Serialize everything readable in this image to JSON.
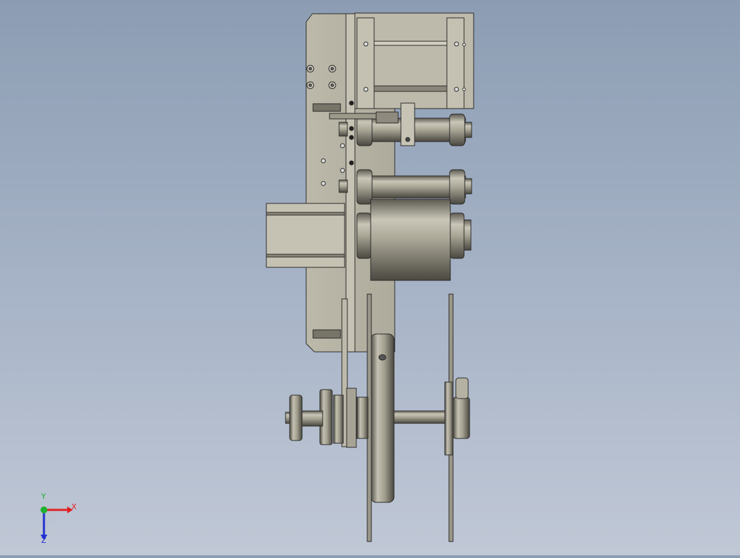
{
  "viewport": {
    "background_top": "#8c9db3",
    "background_bottom": "#c0c8d6",
    "part_color": "#b7b4a4",
    "part_dark": "#6f6c60",
    "edge_color": "#2a2a28"
  },
  "triad": {
    "x_label": "X",
    "y_label": "Y",
    "z_label": "Z",
    "x_color": "#e02020",
    "y_color": "#20b030",
    "z_color": "#2030d0"
  }
}
